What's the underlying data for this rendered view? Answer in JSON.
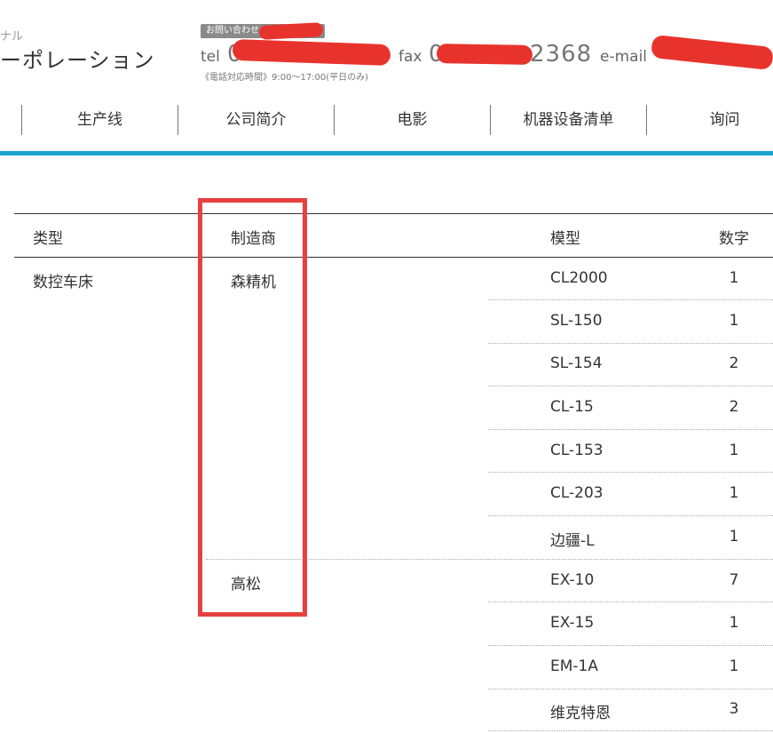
{
  "header": {
    "brand_sub": "ナル",
    "brand_name": "ーポレーション",
    "contact_badge": "お問い合わせ・資料請求は",
    "tel_label": "tel",
    "tel_number": "0",
    "fax_label": "fax",
    "fax_number_prefix": "0",
    "fax_number_suffix": "2368",
    "email_label": "e-mail",
    "hours": "《電話対応時間》9:00～17:00(平日のみ)"
  },
  "nav": {
    "items": [
      {
        "label": "生产线"
      },
      {
        "label": "公司简介"
      },
      {
        "label": "电影"
      },
      {
        "label": "机器设备清单"
      },
      {
        "label": "询问"
      }
    ]
  },
  "table": {
    "headers": {
      "type": "类型",
      "manufacturer": "制造商",
      "model": "模型",
      "count": "数字"
    },
    "type_value": "数控车床",
    "manufacturers": [
      "森精机",
      "高松"
    ],
    "rows": [
      {
        "model": "CL2000",
        "count": "1"
      },
      {
        "model": "SL-150",
        "count": "1"
      },
      {
        "model": "SL-154",
        "count": "2"
      },
      {
        "model": "CL-15",
        "count": "2"
      },
      {
        "model": "CL-153",
        "count": "1"
      },
      {
        "model": "CL-203",
        "count": "1"
      },
      {
        "model": "边疆-L",
        "count": "1"
      },
      {
        "model": "EX-10",
        "count": "7"
      },
      {
        "model": "EX-15",
        "count": "1"
      },
      {
        "model": "EM-1A",
        "count": "1"
      },
      {
        "model": "维克特恩",
        "count": "3"
      }
    ]
  },
  "colors": {
    "accent_bar": "#1aa1cf",
    "highlight_box": "#e8403f",
    "redaction": "#e8332d"
  }
}
